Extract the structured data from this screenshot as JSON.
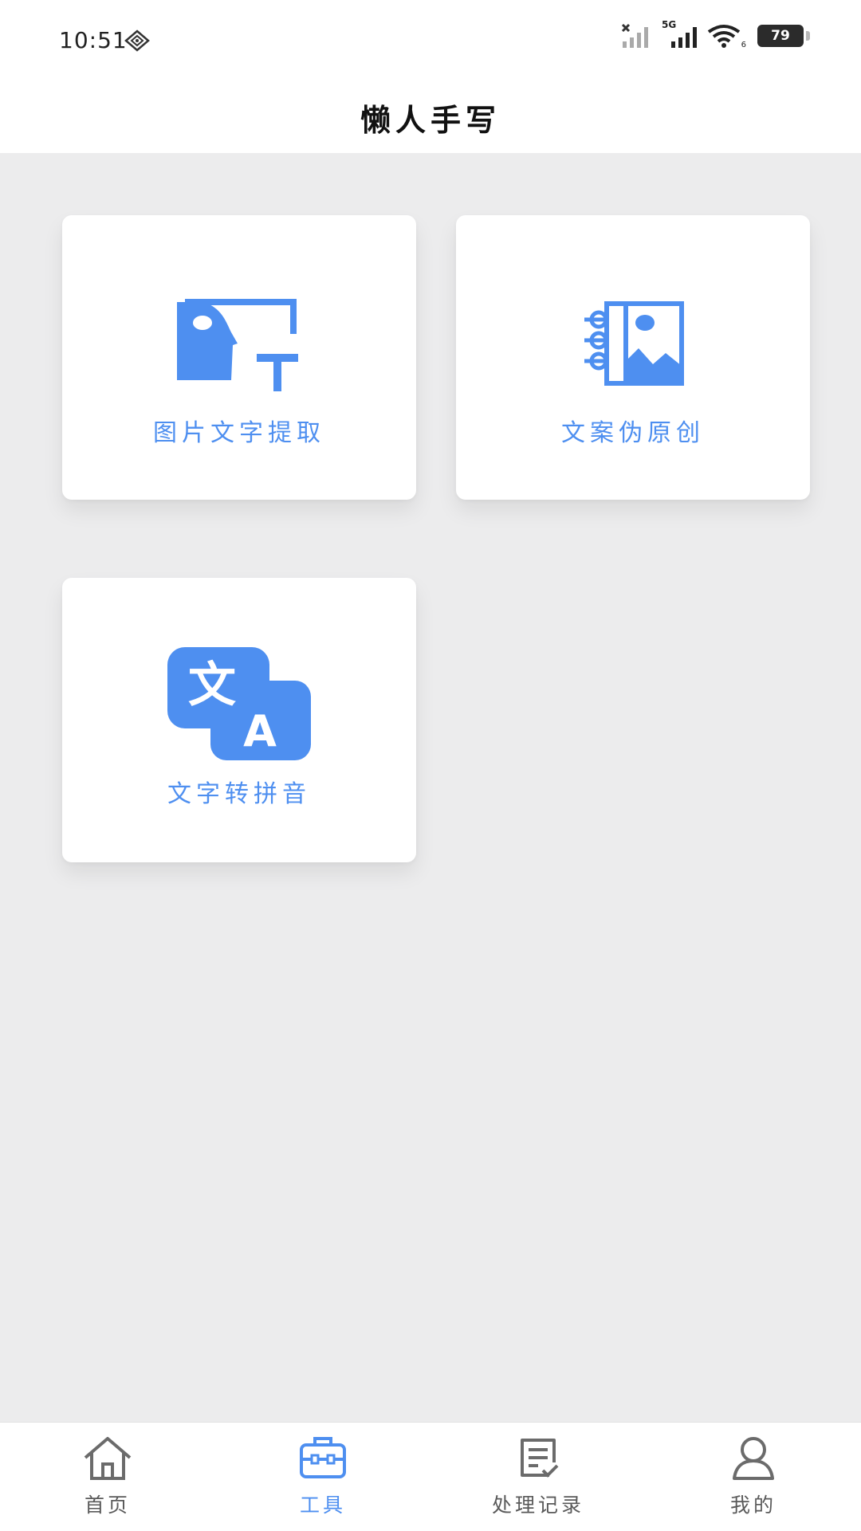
{
  "status_bar": {
    "time": "10:51",
    "network": "5G",
    "wifi_badge": "6",
    "battery": "79"
  },
  "header": {
    "title": "懒人手写"
  },
  "tools": [
    {
      "label": "图片文字提取",
      "icon": "image-text-icon"
    },
    {
      "label": "文案伪原创",
      "icon": "notebook-image-icon"
    },
    {
      "label": "文字转拼音",
      "icon": "translate-icon"
    }
  ],
  "bottom_nav": {
    "items": [
      {
        "label": "首页",
        "icon": "home-icon"
      },
      {
        "label": "工具",
        "icon": "toolbox-icon"
      },
      {
        "label": "处理记录",
        "icon": "record-icon"
      },
      {
        "label": "我的",
        "icon": "user-icon"
      }
    ],
    "active": "工具"
  },
  "colors": {
    "accent": "#4e8ff0",
    "background": "#ececed",
    "card": "#ffffff",
    "nav_inactive": "#5a5a5a"
  }
}
